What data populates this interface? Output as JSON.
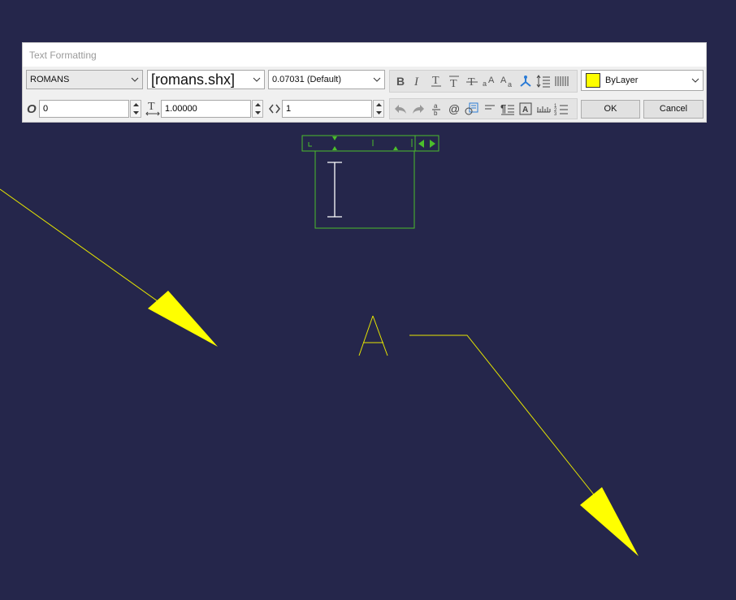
{
  "dialog": {
    "title": "Text Formatting",
    "style_combo": {
      "value": "ROMANS"
    },
    "font_combo": {
      "value": "[romans.shx]"
    },
    "height_combo": {
      "value": "0.07031 (Default)"
    },
    "color_combo": {
      "value": "ByLayer",
      "swatch": "#ffff00"
    },
    "oblique_field": {
      "value": "0"
    },
    "tracking_field": {
      "value": "1.00000"
    },
    "width_field": {
      "value": "1"
    },
    "ok_label": "OK",
    "cancel_label": "Cancel",
    "format_tools": [
      "bold-icon",
      "italic-icon",
      "underline-icon",
      "overline-icon",
      "strikethrough-icon",
      "uppercase-icon",
      "lowercase-icon",
      "stack-icon",
      "line-spacing-icon",
      "columns-icon"
    ],
    "insert_tools": [
      "undo-icon",
      "redo-icon",
      "stack-fraction-icon",
      "symbol-icon",
      "field-icon",
      "justification-icon",
      "paragraph-icon",
      "background-mask-icon",
      "ruler-icon",
      "numbering-icon"
    ]
  },
  "drawing": {
    "text_label": "A",
    "line_color": "#ffff00",
    "editor_color": "#4bbe2b",
    "background": "#25264b"
  }
}
